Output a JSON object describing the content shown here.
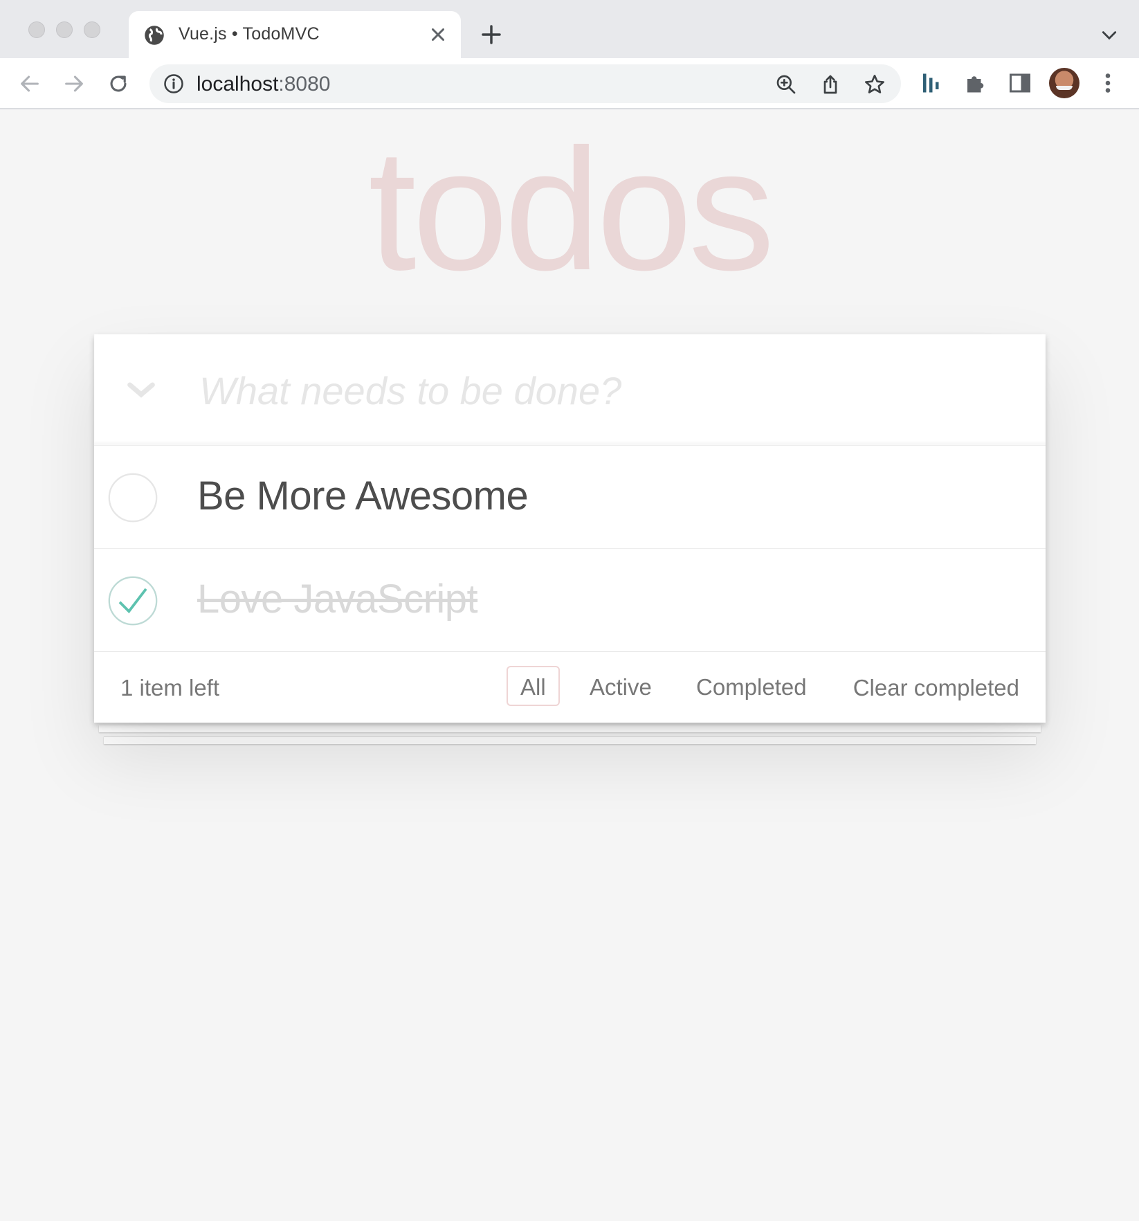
{
  "browser": {
    "tab_title": "Vue.js • TodoMVC",
    "url_host": "localhost",
    "url_port": ":8080",
    "icons": [
      "globe-icon",
      "close-icon",
      "plus-icon",
      "chevron-down-icon",
      "back-icon",
      "forward-icon",
      "reload-icon",
      "info-icon",
      "zoom-icon",
      "share-icon",
      "star-icon",
      "extension-icon",
      "puzzle-icon",
      "sidepanel-icon",
      "avatar",
      "more-icon"
    ]
  },
  "app": {
    "title": "todos",
    "new_todo_placeholder": "What needs to be done?",
    "todos": [
      {
        "label": "Be More Awesome",
        "completed": false
      },
      {
        "label": "Love JavaScript",
        "completed": true
      }
    ],
    "footer": {
      "count_text": "1 item left",
      "filters": [
        "All",
        "Active",
        "Completed"
      ],
      "selected_filter": "All",
      "clear_label": "Clear completed"
    }
  },
  "colors": {
    "title": "#af2f2f",
    "check_done": "#5dc2af",
    "background": "#f5f5f5"
  }
}
